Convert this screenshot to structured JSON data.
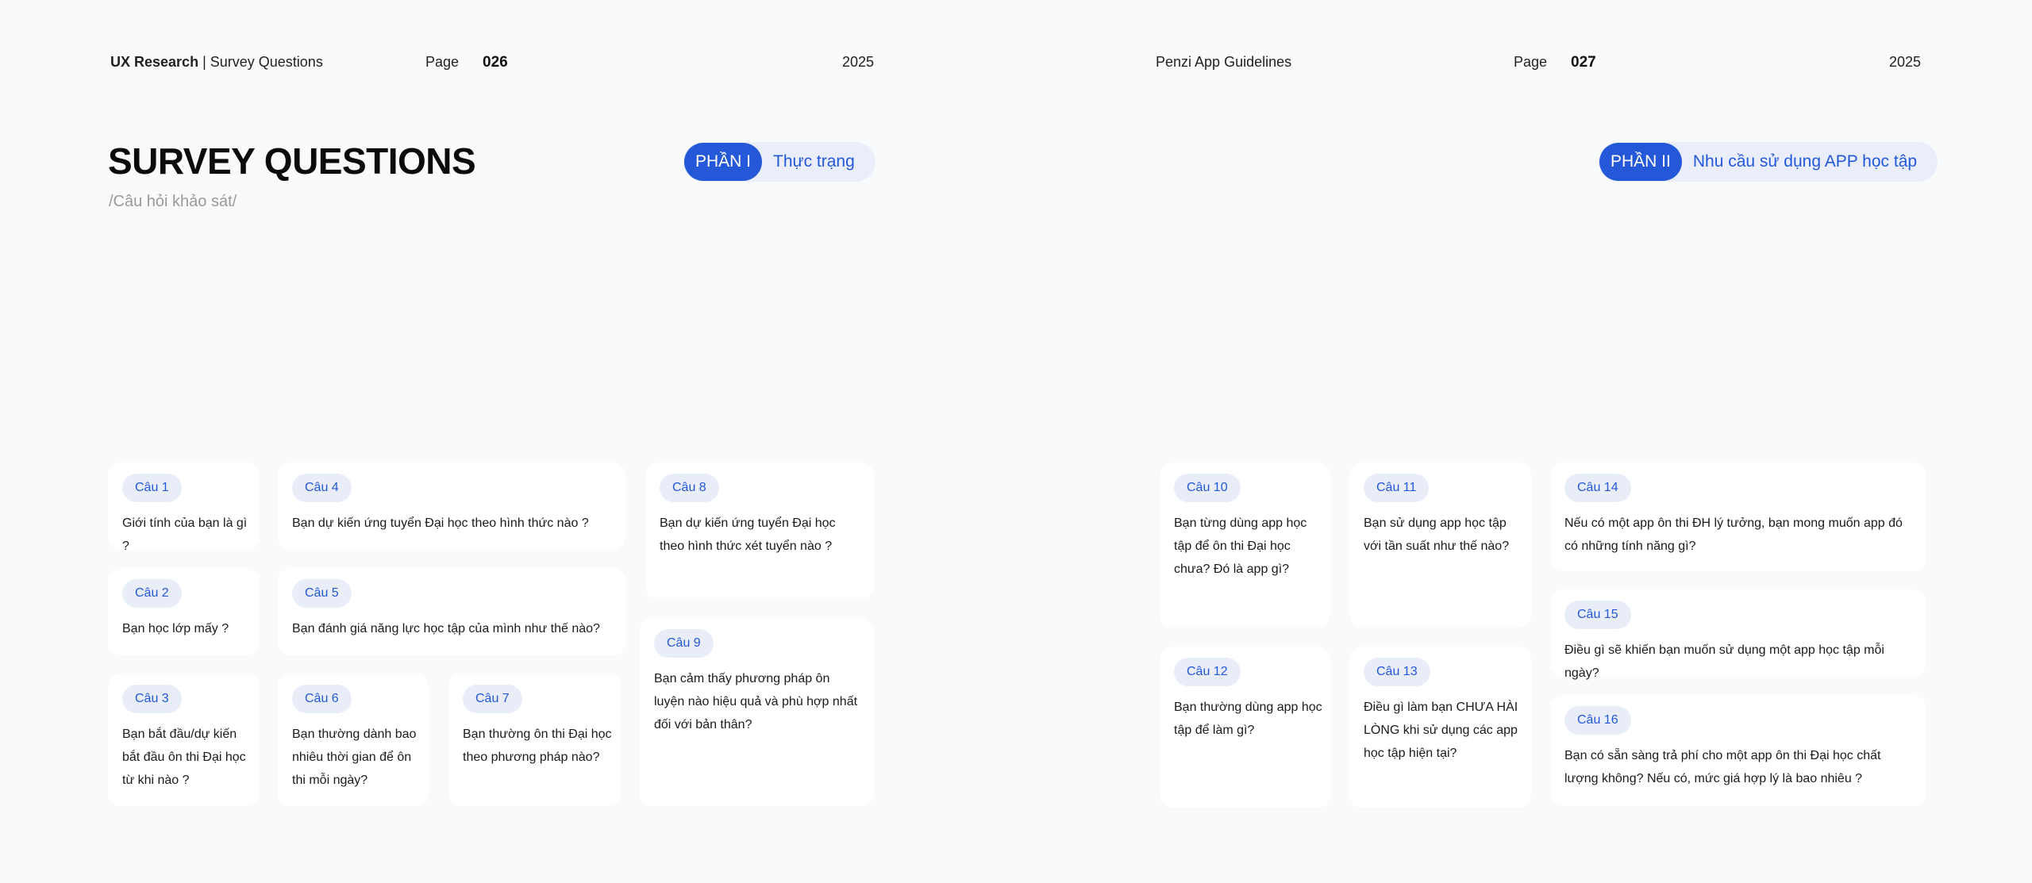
{
  "left_page": {
    "header_brand": "UX Research",
    "header_sep": " | ",
    "header_section": "Survey Questions",
    "page_label": "Page",
    "page_number": "026",
    "year": "2025",
    "title": "SURVEY QUESTIONS",
    "subtitle": "/Câu hỏi khảo sát/",
    "part_tag": "PHẦN I",
    "part_label": "Thực trạng"
  },
  "right_page": {
    "header_section": "Penzi App Guidelines",
    "page_label": "Page",
    "page_number": "027",
    "year": "2025",
    "part_tag": "PHẦN II",
    "part_label": "Nhu cầu sử dụng APP học tập"
  },
  "questions": [
    {
      "label": "Câu 1",
      "text": "Giới tính của bạn là gì ?"
    },
    {
      "label": "Câu 2",
      "text": "Bạn học lớp mấy ?"
    },
    {
      "label": "Câu 3",
      "text": "Bạn bắt đầu/dự kiến bắt đầu ôn thi Đại học từ khi nào ?"
    },
    {
      "label": "Câu 4",
      "text": "Bạn dự kiến ứng tuyển Đại học theo hình thức nào ?"
    },
    {
      "label": "Câu 5",
      "text": "Bạn đánh giá năng lực học tập của mình như thế nào?"
    },
    {
      "label": "Câu 6",
      "text": "Bạn thường dành bao nhiêu thời gian để ôn thi mỗi ngày?"
    },
    {
      "label": "Câu 7",
      "text": "Bạn thường ôn thi Đại học theo phương pháp nào?"
    },
    {
      "label": "Câu 8",
      "text": "Bạn dự kiến ứng tuyển Đại học theo hình thức xét tuyển nào ?"
    },
    {
      "label": "Câu 9",
      "text": "Bạn cảm thấy phương pháp ôn luyện nào hiệu quả và phù hợp nhất đối với bản thân?"
    },
    {
      "label": "Câu 10",
      "text": "Bạn từng dùng app học tập để ôn thi Đại học chưa? Đó là app gì?"
    },
    {
      "label": "Câu 11",
      "text": "Bạn sử dụng app học tập với tần suất như thế nào?"
    },
    {
      "label": "Câu 12",
      "text": "Bạn thường dùng app học tập để làm gì?"
    },
    {
      "label": "Câu 13",
      "text": "Điều gì làm bạn CHƯA HÀI LÒNG khi sử dụng các app học tập hiện tại?"
    },
    {
      "label": "Câu 14",
      "text": "Nếu có một app ôn thi ĐH lý tưởng, bạn mong muốn app đó có những tính năng gì?"
    },
    {
      "label": "Câu 15",
      "text": "Điều gì sẽ khiến bạn muốn sử dụng một app học tập mỗi ngày?"
    },
    {
      "label": "Câu 16",
      "text": "Bạn có sẵn sàng trả phí cho một app ôn thi Đại học chất lượng không? Nếu có, mức giá hợp lý là bao nhiêu ?"
    }
  ]
}
